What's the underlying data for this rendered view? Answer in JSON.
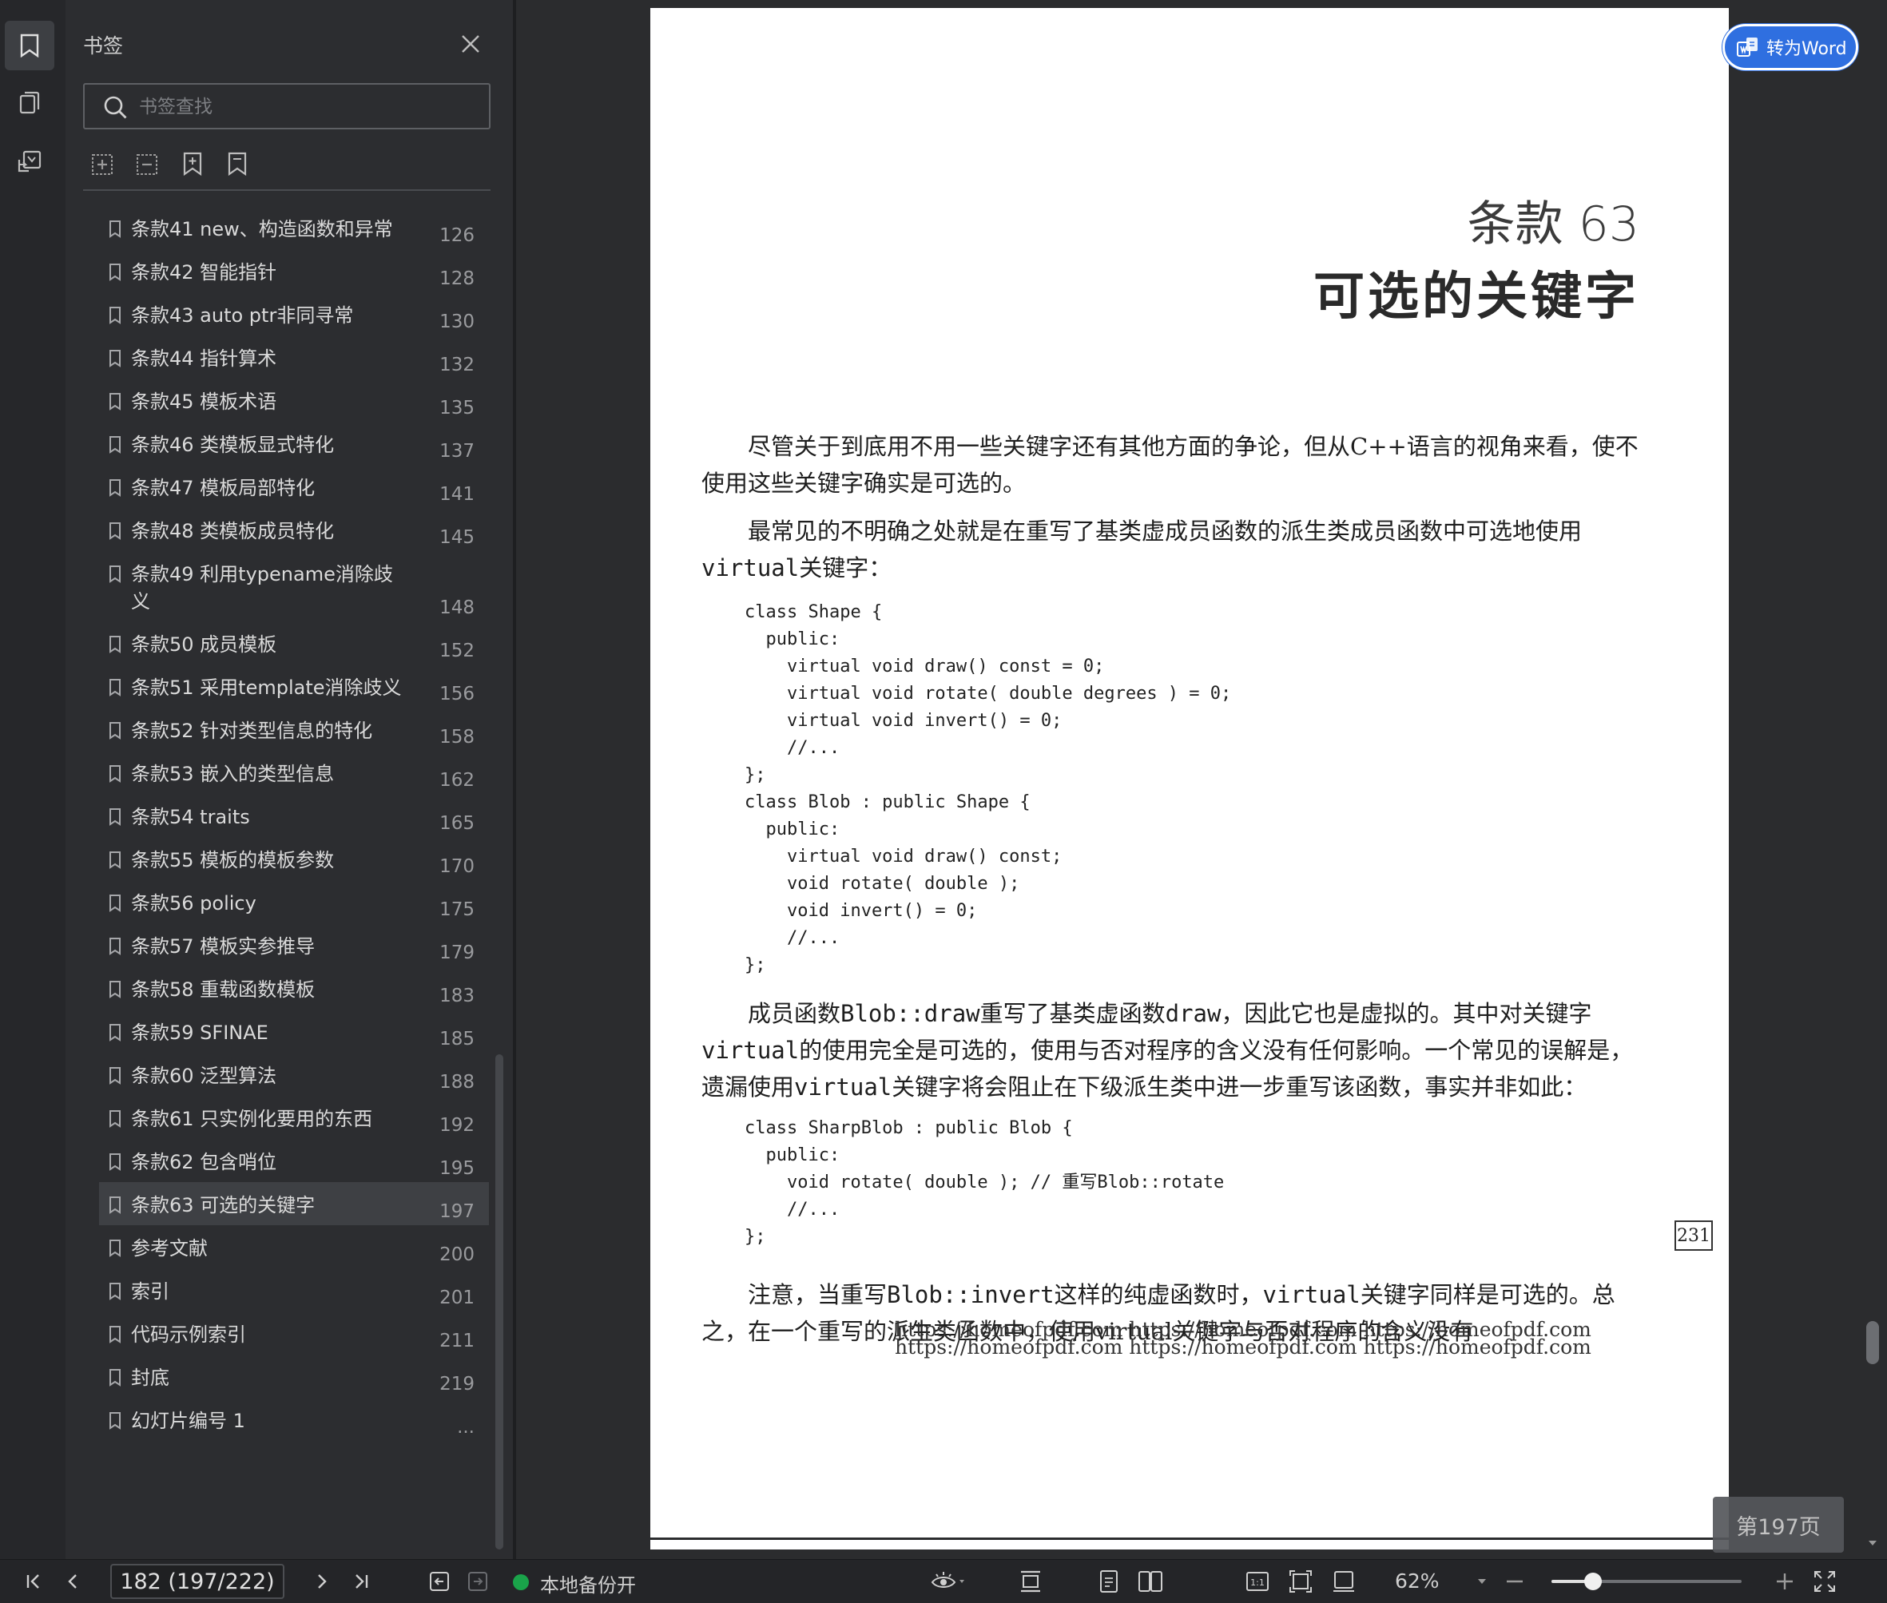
{
  "panel": {
    "title": "书签",
    "search_placeholder": "书签查找",
    "items": [
      {
        "label": "条款41  new、构造函数和异常",
        "page": "126"
      },
      {
        "label": "条款42  智能指针",
        "page": "128"
      },
      {
        "label": "条款43  auto ptr非同寻常",
        "page": "130"
      },
      {
        "label": "条款44  指针算术",
        "page": "132"
      },
      {
        "label": "条款45  模板术语",
        "page": "135"
      },
      {
        "label": "条款46  类模板显式特化",
        "page": "137"
      },
      {
        "label": "条款47  模板局部特化",
        "page": "141"
      },
      {
        "label": "条款48  类模板成员特化",
        "page": "145"
      },
      {
        "label": "条款49  利用typename消除歧义",
        "page": "148"
      },
      {
        "label": "条款50  成员模板",
        "page": "152"
      },
      {
        "label": "条款51  采用template消除歧义",
        "page": "156"
      },
      {
        "label": "条款52  针对类型信息的特化",
        "page": "158"
      },
      {
        "label": "条款53  嵌入的类型信息",
        "page": "162"
      },
      {
        "label": "条款54  traits",
        "page": "165"
      },
      {
        "label": "条款55  模板的模板参数",
        "page": "170"
      },
      {
        "label": "条款56  policy",
        "page": "175"
      },
      {
        "label": "条款57  模板实参推导",
        "page": "179"
      },
      {
        "label": "条款58  重载函数模板",
        "page": "183"
      },
      {
        "label": "条款59  SFINAE",
        "page": "185"
      },
      {
        "label": "条款60  泛型算法",
        "page": "188"
      },
      {
        "label": "条款61  只实例化要用的东西",
        "page": "192"
      },
      {
        "label": "条款62  包含哨位",
        "page": "195"
      },
      {
        "label": "条款63  可选的关键字",
        "page": "197"
      },
      {
        "label": "参考文献",
        "page": "200"
      },
      {
        "label": "索引",
        "page": "201"
      },
      {
        "label": "代码示例索引",
        "page": "211"
      },
      {
        "label": "封底",
        "page": "219"
      },
      {
        "label": "幻灯片编号 1",
        "page": "..."
      }
    ],
    "active_index": 22
  },
  "document": {
    "chapter_num": "条款 63",
    "chapter_title": "可选的关键字",
    "para1": "尽管关于到底用不用一些关键字还有其他方面的争论，但从C++语言的视角来看，使不使用这些关键字确实是可选的。",
    "para2_a": "最常见的不明确之处就是在重写了基类虚成员函数的派生类成员函数中可选地使用",
    "para2_code": "virtual",
    "para2_b": "关键字：",
    "code1": "class Shape {\n  public:\n    virtual void draw() const = 0;\n    virtual void rotate( double degrees ) = 0;\n    virtual void invert() = 0;\n    //...\n};\nclass Blob : public Shape {\n  public:\n    virtual void draw() const;\n    void rotate( double );\n    void invert() = 0;\n    //...\n};",
    "para3_a": "成员函数",
    "para3_code1": "Blob::draw",
    "para3_b": "重写了基类虚函数",
    "para3_code2": "draw",
    "para3_c": "，因此它也是虚拟的。其中对关键字",
    "para3_code3": "virtual",
    "para3_d": "的使用完全是可选的，使用与否对程序的含义没有任何影响。一个常见的误解是，遗漏使用",
    "para3_code4": "virtual",
    "para3_e": "关键字将会阻止在下级派生类中进一步重写该函数，事实并非如此：",
    "code2": "class SharpBlob : public Blob {\n  public:\n    void rotate( double ); // 重写Blob::rotate\n    //...\n};",
    "para4_a": "注意，当重写",
    "para4_code1": "Blob::invert",
    "para4_b": "这样的纯虚函数时，",
    "para4_code2": "virtual",
    "para4_c": "关键字同样是可选的。总之，在一个重写的派生类函数中，使用virtual关键字与否对程序的含义没有",
    "page_number": "231",
    "watermark_1": "https://homeofpdf.com https://homeofpdf.com https://homeofpdf.com",
    "watermark_2": "https://homeofpdf.com https://homeofpdf.com https://homeofpdf.com"
  },
  "to_word_label": "转为Word",
  "page_badge": "第197页",
  "status": {
    "page_field": "182 (197/222)",
    "backup": "本地备份开",
    "zoom": "62%",
    "zoom_fraction": 0.22
  }
}
